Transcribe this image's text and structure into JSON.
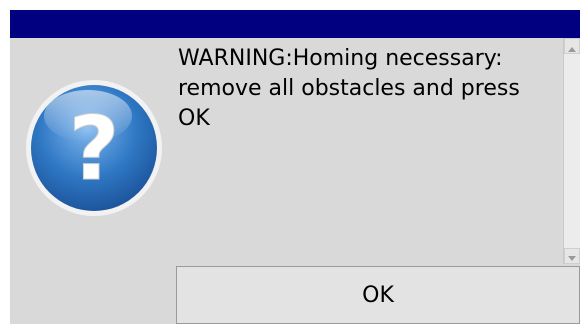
{
  "dialog": {
    "title": "",
    "icon": "question-icon",
    "message": "WARNING:Homing necessary:\nremove all obstacles and press\nOK",
    "ok_label": "OK"
  },
  "colors": {
    "titlebar": "#000080",
    "client_background": "#d9d9d9",
    "icon_blue": "#2f78c4"
  }
}
